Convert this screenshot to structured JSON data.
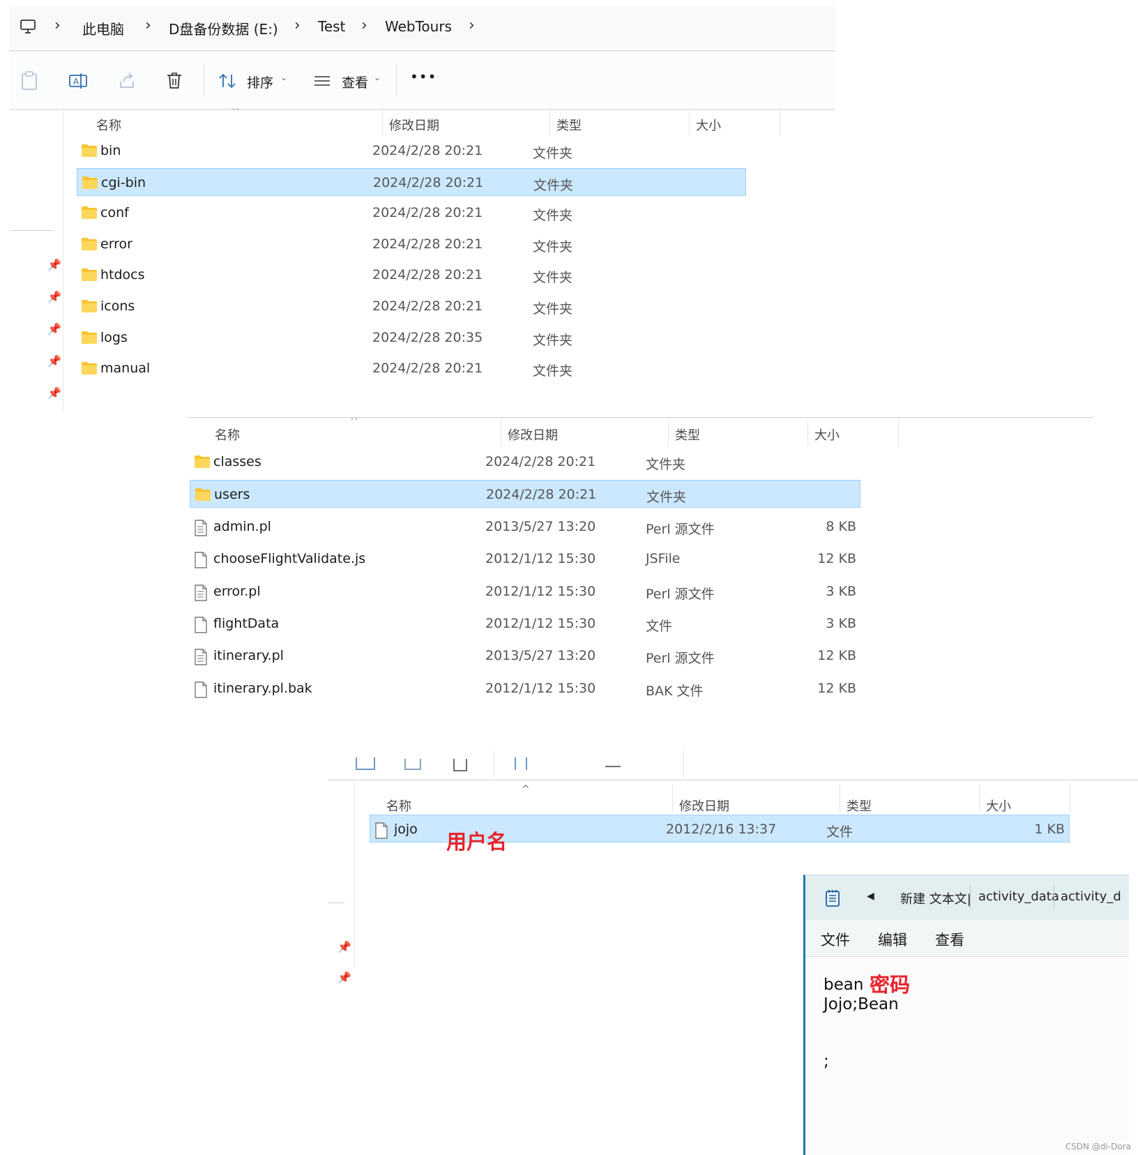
{
  "address_bar": {
    "items": [
      "此电脑",
      "D盘备份数据 (E:)",
      "Test",
      "WebTours"
    ]
  },
  "toolbar": {
    "sort_label": "排序",
    "view_label": "查看",
    "more_label": "•••"
  },
  "columns": {
    "name": "名称",
    "modified": "修改日期",
    "type": "类型",
    "size": "大小"
  },
  "pane1": {
    "rows": [
      {
        "name": "bin",
        "date": "2024/2/28 20:21",
        "type": "文件夹",
        "size": ""
      },
      {
        "name": "cgi-bin",
        "date": "2024/2/28 20:21",
        "type": "文件夹",
        "size": ""
      },
      {
        "name": "conf",
        "date": "2024/2/28 20:21",
        "type": "文件夹",
        "size": ""
      },
      {
        "name": "error",
        "date": "2024/2/28 20:21",
        "type": "文件夹",
        "size": ""
      },
      {
        "name": "htdocs",
        "date": "2024/2/28 20:21",
        "type": "文件夹",
        "size": ""
      },
      {
        "name": "icons",
        "date": "2024/2/28 20:21",
        "type": "文件夹",
        "size": ""
      },
      {
        "name": "logs",
        "date": "2024/2/28 20:35",
        "type": "文件夹",
        "size": ""
      },
      {
        "name": "manual",
        "date": "2024/2/28 20:21",
        "type": "文件夹",
        "size": ""
      }
    ],
    "selected_index": 1
  },
  "pane2": {
    "rows": [
      {
        "name": "classes",
        "date": "2024/2/28 20:21",
        "type": "文件夹",
        "size": "",
        "kind": "folder"
      },
      {
        "name": "users",
        "date": "2024/2/28 20:21",
        "type": "文件夹",
        "size": "",
        "kind": "folder"
      },
      {
        "name": "admin.pl",
        "date": "2013/5/27 13:20",
        "type": "Perl 源文件",
        "size": "8 KB",
        "kind": "text"
      },
      {
        "name": "chooseFlightValidate.js",
        "date": "2012/1/12 15:30",
        "type": "JSFile",
        "size": "12 KB",
        "kind": "blank"
      },
      {
        "name": "error.pl",
        "date": "2012/1/12 15:30",
        "type": "Perl 源文件",
        "size": "3 KB",
        "kind": "text"
      },
      {
        "name": "flightData",
        "date": "2012/1/12 15:30",
        "type": "文件",
        "size": "3 KB",
        "kind": "blank"
      },
      {
        "name": "itinerary.pl",
        "date": "2013/5/27 13:20",
        "type": "Perl 源文件",
        "size": "12 KB",
        "kind": "text"
      },
      {
        "name": "itinerary.pl.bak",
        "date": "2012/1/12 15:30",
        "type": "BAK 文件",
        "size": "12 KB",
        "kind": "blank"
      }
    ],
    "selected_index": 1
  },
  "pane3": {
    "rows": [
      {
        "name": "jojo",
        "date": "2012/2/16 13:37",
        "type": "文件",
        "size": "1 KB",
        "kind": "blank"
      }
    ],
    "annotation": "用户名"
  },
  "notepad": {
    "tabs": [
      "新建 文本文|",
      "activity_data",
      "activity_d"
    ],
    "menu": [
      "文件",
      "编辑",
      "查看"
    ],
    "lines": [
      "bean",
      "Jojo;Bean",
      ";"
    ],
    "annotation": "密码"
  },
  "watermark": "CSDN @di-Dora",
  "colors": {
    "selection": "#cce8ff",
    "selection_border": "#99d1ff",
    "folder": "#f8c430",
    "annotation": "#e8232b"
  }
}
